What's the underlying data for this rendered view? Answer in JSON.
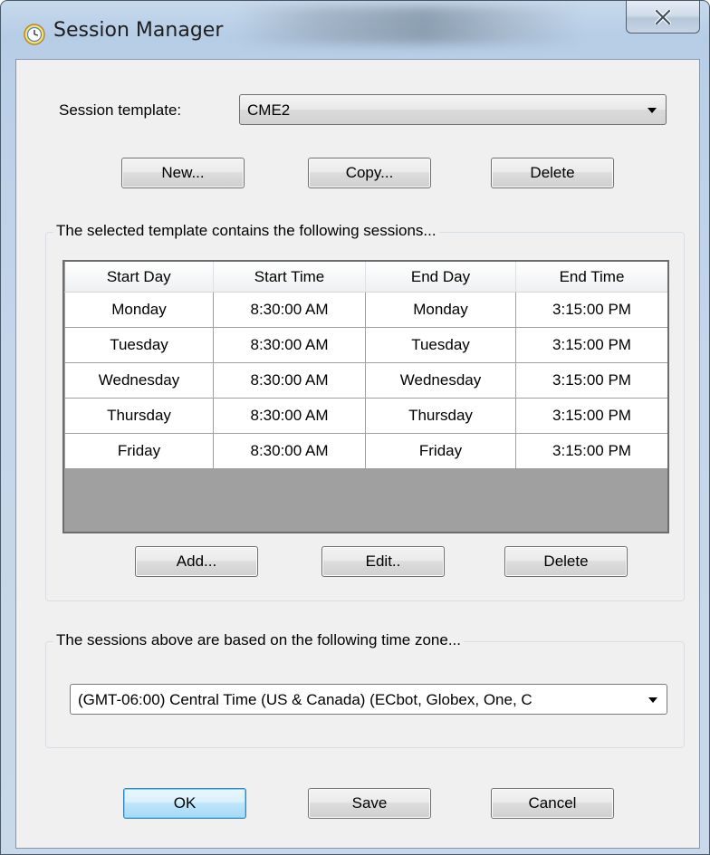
{
  "window": {
    "title": "Session Manager",
    "close_glyph": "X"
  },
  "session_template": {
    "label": "Session template:",
    "value": "CME2"
  },
  "template_buttons": {
    "new": "New...",
    "copy": "Copy...",
    "delete": "Delete"
  },
  "sessions_group": {
    "title": "The selected template contains the following sessions...",
    "columns": [
      "Start Day",
      "Start Time",
      "End Day",
      "End Time"
    ],
    "rows": [
      [
        "Monday",
        "8:30:00 AM",
        "Monday",
        "3:15:00 PM"
      ],
      [
        "Tuesday",
        "8:30:00 AM",
        "Tuesday",
        "3:15:00 PM"
      ],
      [
        "Wednesday",
        "8:30:00 AM",
        "Wednesday",
        "3:15:00 PM"
      ],
      [
        "Thursday",
        "8:30:00 AM",
        "Thursday",
        "3:15:00 PM"
      ],
      [
        "Friday",
        "8:30:00 AM",
        "Friday",
        "3:15:00 PM"
      ]
    ],
    "buttons": {
      "add": "Add...",
      "edit": "Edit..",
      "delete": "Delete"
    }
  },
  "timezone_group": {
    "title": "The sessions above are based on the following time zone...",
    "value": "(GMT-06:00) Central Time (US & Canada) (ECbot, Globex, One, C"
  },
  "footer_buttons": {
    "ok": "OK",
    "save": "Save",
    "cancel": "Cancel"
  },
  "colors": {
    "default_button_border": "#3c7fb1",
    "grid_empty_area": "#a0a0a0"
  }
}
